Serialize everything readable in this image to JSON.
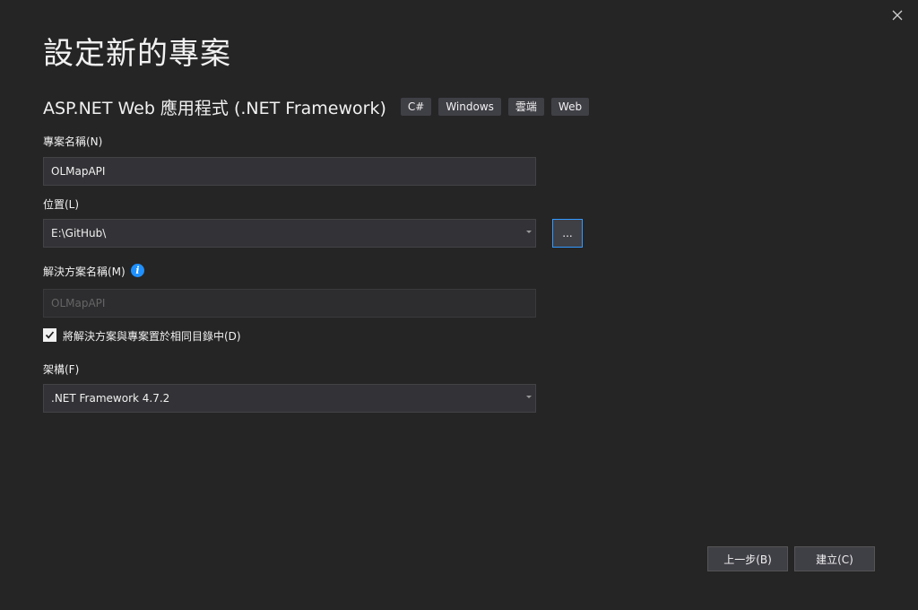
{
  "dialog": {
    "title": "設定新的專案",
    "close_icon": "close-icon"
  },
  "template": {
    "name": "ASP.NET Web 應用程式 (.NET Framework)",
    "tags": [
      "C#",
      "Windows",
      "雲端",
      "Web"
    ]
  },
  "project_name": {
    "label": "專案名稱(N)",
    "value": "OLMapAPI"
  },
  "location": {
    "label": "位置(L)",
    "value": "E:\\GitHub\\",
    "browse_label": "..."
  },
  "solution_name": {
    "label": "解決方案名稱(M)",
    "value": "OLMapAPI",
    "disabled": true,
    "info_icon": "info-icon"
  },
  "same_directory": {
    "label": "將解決方案與專案置於相同目錄中(D)",
    "checked": true
  },
  "framework": {
    "label": "架構(F)",
    "value": ".NET Framework 4.7.2"
  },
  "footer": {
    "back_label": "上一步(B)",
    "create_label": "建立(C)"
  },
  "colors": {
    "background": "#252526",
    "input_background": "#333337",
    "accent": "#3399ff",
    "info": "#1e90ff"
  }
}
